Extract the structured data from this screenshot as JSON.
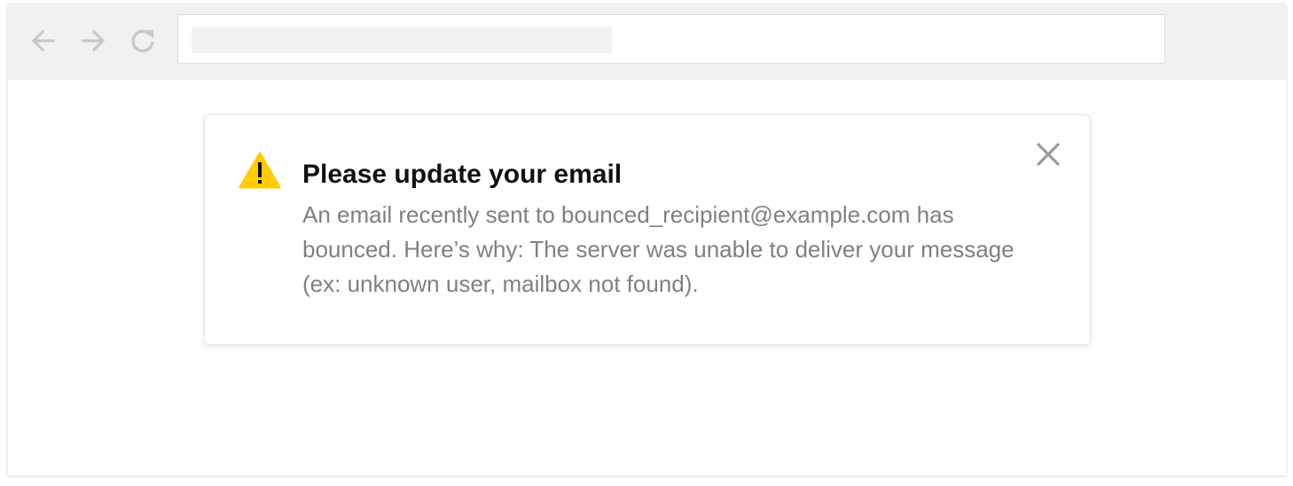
{
  "toolbar": {
    "back_icon": "arrow-left-icon",
    "forward_icon": "arrow-right-icon",
    "reload_icon": "reload-icon",
    "icon_color": "#c8c8c8"
  },
  "alert": {
    "icon": "warning-triangle-icon",
    "icon_color": "#ffcc00",
    "title": "Please update your email",
    "body": "An email recently sent to bounced_recipient@example.com has bounced. Here’s why: The server was unable to deliver your message (ex: unknown user, mailbox not found).",
    "close_icon": "close-icon",
    "close_color": "#9a9a9a"
  }
}
